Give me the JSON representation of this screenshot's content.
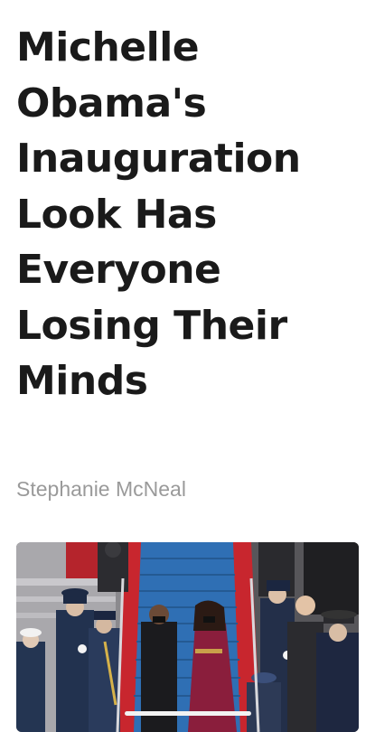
{
  "article": {
    "headline": "Michelle Obama's Inauguration Look Has Everyone Losing Their Minds",
    "byline": "Stephanie McNeal"
  },
  "hero_image": {
    "subject": "Michelle and Barack Obama walking down a red-and-blue carpeted staircase between uniformed honor guards"
  },
  "colors": {
    "headline": "#1a1a1a",
    "byline": "#9a9a9a",
    "carpet_red": "#c8262e",
    "carpet_blue": "#2f6fb4",
    "coat_plum": "#8a1e3c"
  }
}
